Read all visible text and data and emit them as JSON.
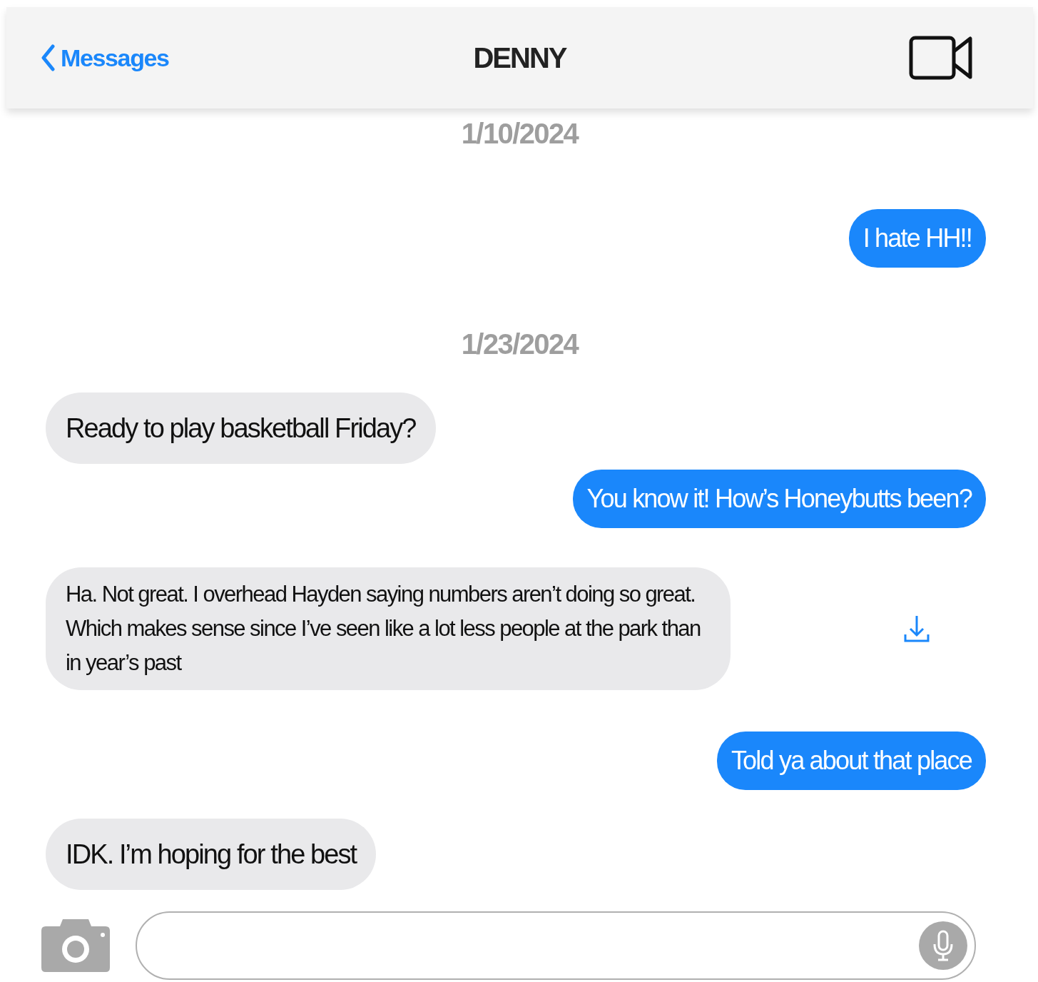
{
  "header": {
    "back_label": "Messages",
    "title": "DENNY"
  },
  "messages": [
    {
      "kind": "date",
      "text": "1/10/2024"
    },
    {
      "kind": "sent",
      "text": "I hate HH!!"
    },
    {
      "kind": "date",
      "text": "1/23/2024"
    },
    {
      "kind": "received",
      "text": "Ready to play basketball Friday?",
      "download": false
    },
    {
      "kind": "sent",
      "text": "You know it! How’s Honeybutts been?"
    },
    {
      "kind": "received",
      "text": "Ha. Not great. I overhead Hayden saying numbers aren’t doing so great. Which makes sense since I’ve seen like a lot less people at the park than in year’s past",
      "download": true
    },
    {
      "kind": "sent",
      "text": "Told ya about that place"
    },
    {
      "kind": "received",
      "text": "IDK. I’m hoping for the best",
      "download": false
    }
  ]
}
